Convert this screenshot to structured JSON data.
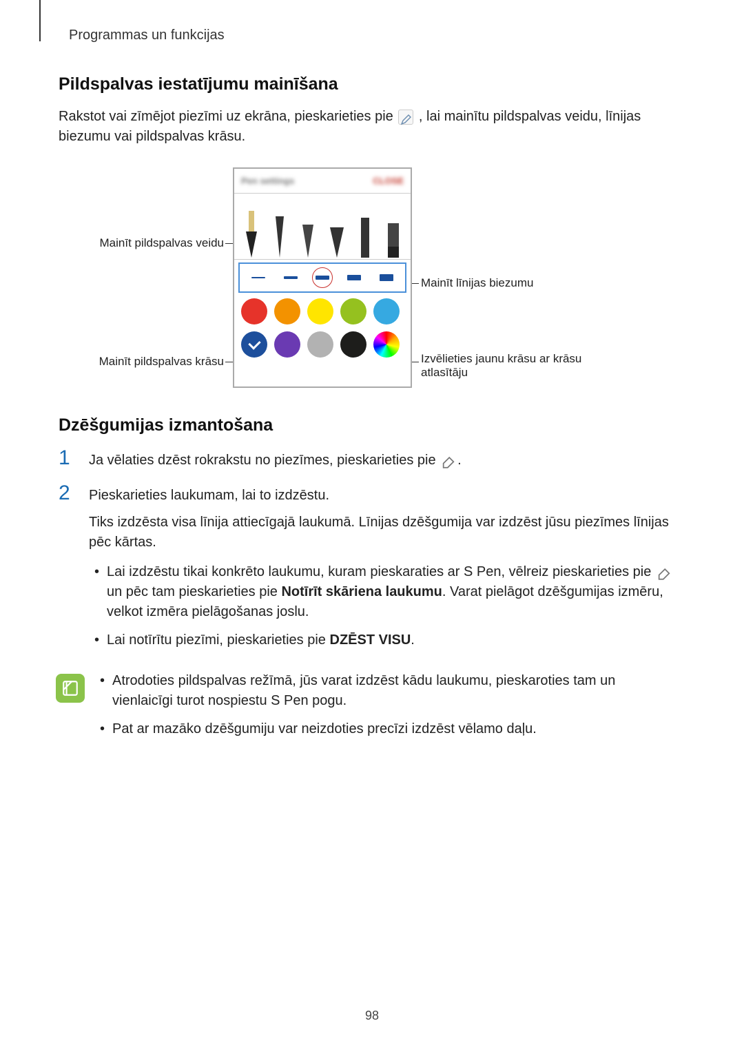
{
  "header": {
    "breadcrumb": "Programmas un funkcijas"
  },
  "section1": {
    "heading": "Pildspalvas iestatījumu mainīšana",
    "para_before_icon": "Rakstot vai zīmējot piezīmi uz ekrāna, pieskarieties pie ",
    "para_after_icon": ", lai mainītu pildspalvas veidu, līnijas biezumu vai pildspalvas krāsu."
  },
  "diagram": {
    "panel_title_blur": "Pen settings",
    "panel_action_blur": "CLOSE",
    "callouts": {
      "pen_type": "Mainīt pildspalvas veidu",
      "pen_color": "Mainīt pildspalvas krāsu",
      "line_thickness": "Mainīt līnijas biezumu",
      "color_picker": "Izvēlieties jaunu krāsu ar krāsu atlasītāju"
    },
    "colors": [
      "#e6332a",
      "#f39200",
      "#ffe500",
      "#95c11f",
      "#36a9e1",
      "#1d4f9c",
      "#9b57b6",
      "#b2b2b2",
      "#1d1d1b",
      "rainbow"
    ]
  },
  "section2": {
    "heading": "Dzēšgumijas izmantošana",
    "steps": [
      {
        "num": "1",
        "text_before": "Ja vēlaties dzēst rokrakstu no piezīmes, pieskarieties pie ",
        "text_after": "."
      },
      {
        "num": "2",
        "text": "Pieskarieties laukumam, lai to izdzēstu.",
        "para2": "Tiks izdzēsta visa līnija attiecīgajā laukumā. Līnijas dzēšgumija var izdzēst jūsu piezīmes līnijas pēc kārtas.",
        "bullets": [
          {
            "pre": "Lai izdzēstu tikai konkrēto laukumu, kuram pieskaraties ar S Pen, vēlreiz pieskarieties pie ",
            "mid": " un pēc tam pieskarieties pie ",
            "bold": "Notīrīt skāriena laukumu",
            "post": ". Varat pielāgot dzēšgumijas izmēru, velkot izmēra pielāgošanas joslu."
          },
          {
            "pre": "Lai notīrītu piezīmi, pieskarieties pie ",
            "bold": "DZĒST VISU",
            "post": "."
          }
        ]
      }
    ],
    "notes": [
      "Atrodoties pildspalvas režīmā, jūs varat izdzēst kādu laukumu, pieskaroties tam un vienlaicīgi turot nospiestu S Pen pogu.",
      "Pat ar mazāko dzēšgumiju var neizdoties precīzi izdzēst vēlamo daļu."
    ]
  },
  "page_number": "98"
}
